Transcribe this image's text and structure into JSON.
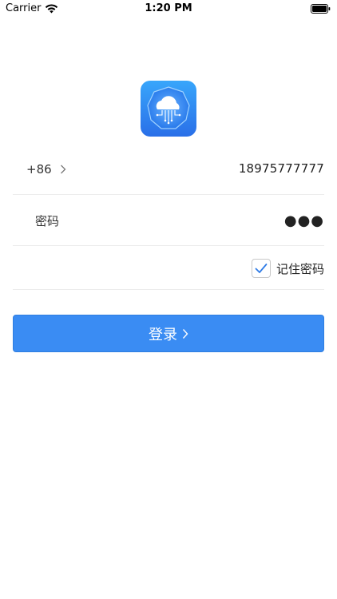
{
  "status_bar": {
    "carrier": "Carrier",
    "time": "1:20 PM",
    "wifi_icon": "wifi-icon",
    "battery_icon": "battery-icon"
  },
  "app_logo": {
    "icon": "cloud-circuit-icon",
    "bg_top": "#38a6fb",
    "bg_bottom": "#2a6fe8"
  },
  "login_form": {
    "country_code": "+86",
    "phone_number": "18975777777",
    "password_label": "密码",
    "password_masked": "●●●",
    "remember_label": "记住密码",
    "remember_checked": true,
    "login_label": "登录"
  },
  "colors": {
    "accent": "#3a8cf3",
    "divider": "#ececec"
  }
}
